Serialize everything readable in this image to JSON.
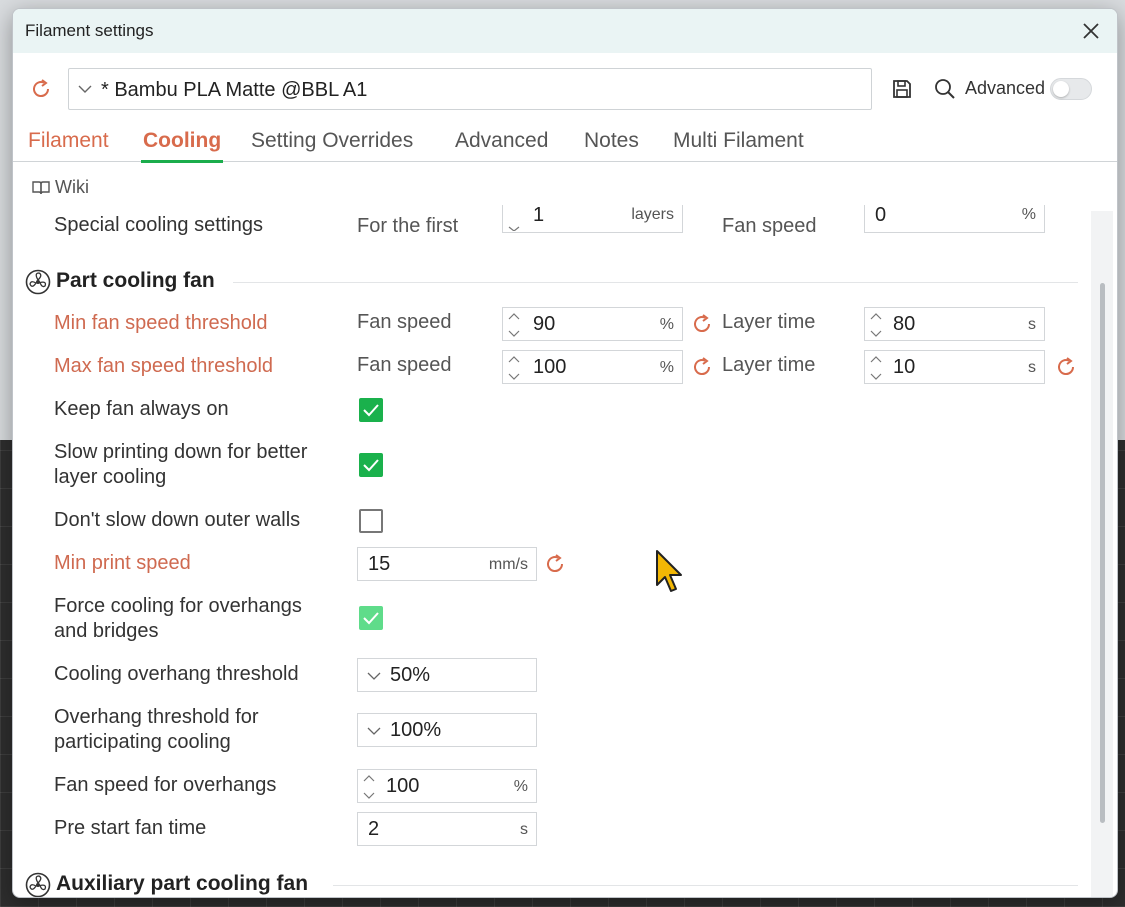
{
  "window": {
    "title": "Filament settings"
  },
  "preset": {
    "name": "* Bambu PLA Matte @BBL A1"
  },
  "toolbar": {
    "advanced_label": "Advanced"
  },
  "tabs": [
    {
      "label": "Filament"
    },
    {
      "label": "Cooling"
    },
    {
      "label": "Setting Overrides"
    },
    {
      "label": "Advanced"
    },
    {
      "label": "Notes"
    },
    {
      "label": "Multi Filament"
    }
  ],
  "wiki": {
    "label": "Wiki"
  },
  "special": {
    "label": "Special cooling settings",
    "first_label": "For the first",
    "first_value": "1",
    "first_unit": "layers",
    "fan_label": "Fan speed",
    "fan_value": "0",
    "fan_unit": "%"
  },
  "sections": {
    "part_cooling": "Part cooling fan",
    "aux_cooling": "Auxiliary part cooling fan"
  },
  "min_fan": {
    "label": "Min fan speed threshold",
    "fan_label": "Fan speed",
    "fan_value": "90",
    "fan_unit": "%",
    "time_label": "Layer time",
    "time_value": "80",
    "time_unit": "s"
  },
  "max_fan": {
    "label": "Max fan speed threshold",
    "fan_label": "Fan speed",
    "fan_value": "100",
    "fan_unit": "%",
    "time_label": "Layer time",
    "time_value": "10",
    "time_unit": "s"
  },
  "keep_fan": {
    "label": "Keep fan always on",
    "checked": true
  },
  "slow_printing": {
    "label_line1": "Slow printing down for better",
    "label_line2": "layer cooling",
    "checked": true
  },
  "dont_slow": {
    "label": "Don't slow down outer walls",
    "checked": false
  },
  "min_print_speed": {
    "label": "Min print speed",
    "value": "15",
    "unit": "mm/s"
  },
  "force_cooling": {
    "label_line1": "Force cooling for overhangs",
    "label_line2": "and bridges",
    "checked": true
  },
  "cooling_overhang": {
    "label": "Cooling overhang threshold",
    "value": "50%"
  },
  "overhang_participating": {
    "label_line1": "Overhang threshold for",
    "label_line2": "participating cooling",
    "value": "100%"
  },
  "fan_overhangs": {
    "label": "Fan speed for overhangs",
    "value": "100",
    "unit": "%"
  },
  "pre_start": {
    "label": "Pre start fan time",
    "value": "2",
    "unit": "s"
  },
  "colors": {
    "accent_orange": "#d86b4c",
    "accent_green": "#1ab14c"
  }
}
